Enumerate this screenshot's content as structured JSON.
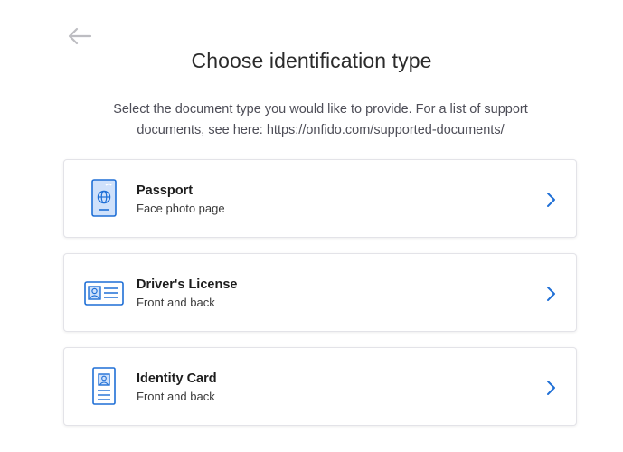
{
  "page": {
    "title": "Choose identification type",
    "subtitle": "Select the document type you would like to provide. For a list of support documents, see here: https://onfido.com/supported-documents/"
  },
  "options": [
    {
      "label": "Passport",
      "sub": "Face photo page",
      "icon": "passport-icon"
    },
    {
      "label": "Driver's License",
      "sub": "Front and back",
      "icon": "drivers-license-icon"
    },
    {
      "label": "Identity Card",
      "sub": "Front and back",
      "icon": "identity-card-icon"
    }
  ],
  "colors": {
    "accent": "#1f6fd6",
    "icon_fill": "#cfe1fb",
    "back_arrow": "#bdbdc2"
  }
}
